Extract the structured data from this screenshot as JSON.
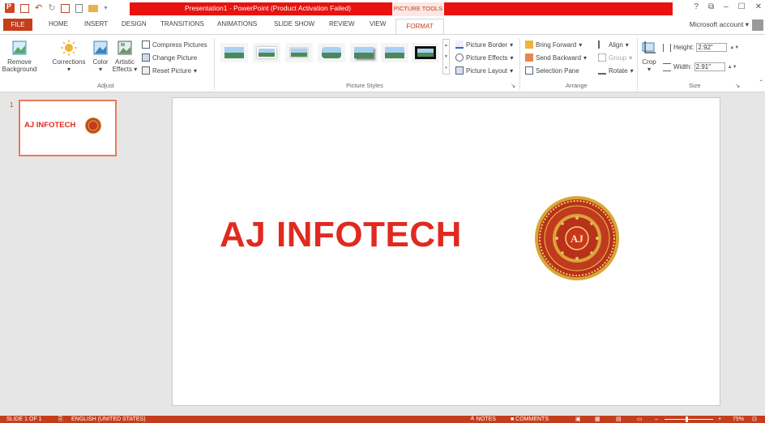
{
  "titlebar": {
    "title": "Presentation1 - PowerPoint (Product Activation Failed)",
    "picture_tools": "PICTURE TOOLS",
    "help": "?",
    "restore": "⧉",
    "minimize": "–",
    "maximize": "☐",
    "close": "✕"
  },
  "tabs": {
    "file": "FILE",
    "home": "HOME",
    "insert": "INSERT",
    "design": "DESIGN",
    "transitions": "TRANSITIONS",
    "animations": "ANIMATIONS",
    "slideshow": "SLIDE SHOW",
    "review": "REVIEW",
    "view": "VIEW",
    "format": "FORMAT"
  },
  "account": "Microsoft account",
  "ribbon": {
    "adjust": {
      "remove_bg_1": "Remove",
      "remove_bg_2": "Background",
      "corrections": "Corrections",
      "color": "Color",
      "artistic_1": "Artistic",
      "artistic_2": "Effects",
      "compress": "Compress Pictures",
      "change": "Change Picture",
      "reset": "Reset Picture",
      "label": "Adjust"
    },
    "styles": {
      "label": "Picture Styles",
      "border": "Picture Border",
      "effects": "Picture Effects",
      "layout": "Picture Layout"
    },
    "arrange": {
      "label": "Arrange",
      "bring_forward": "Bring Forward",
      "send_backward": "Send Backward",
      "selection_pane": "Selection Pane",
      "align": "Align",
      "group": "Group",
      "rotate": "Rotate"
    },
    "size": {
      "label": "Size",
      "crop": "Crop",
      "height_label": "Height:",
      "height_value": "2.92\"",
      "width_label": "Width:",
      "width_value": "2.91\""
    }
  },
  "thumbnails": {
    "slide_number": "1",
    "thumb_text": "AJ INFOTECH"
  },
  "slide": {
    "title": "AJ INFOTECH",
    "logo_text": "AJ"
  },
  "statusbar": {
    "slide_info": "SLIDE 1 OF 1",
    "language": "ENGLISH (UNITED STATES)",
    "notes": "≜ NOTES",
    "comments": "■ COMMENTS",
    "zoom": "75%"
  },
  "colors": {
    "accent": "#c43e1c",
    "title_red": "#e8120e",
    "slide_text": "#e02a1f"
  }
}
